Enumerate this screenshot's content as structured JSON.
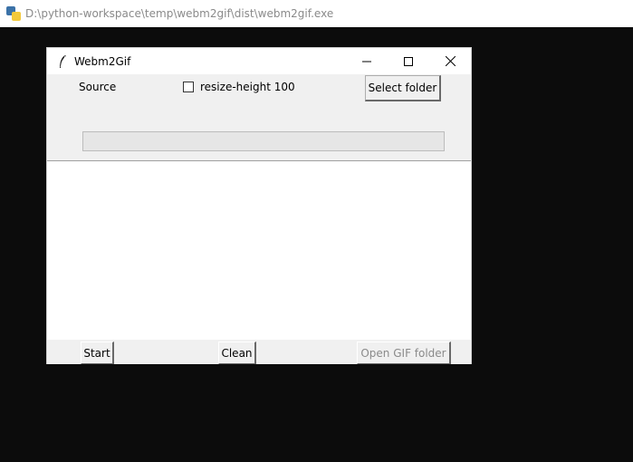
{
  "console": {
    "title": "D:\\python-workspace\\temp\\webm2gif\\dist\\webm2gif.exe",
    "icon": "python-icon"
  },
  "app": {
    "title": "Webm2Gif",
    "icon": "tk-feather-icon",
    "controls": {
      "minimize": "minimize-icon",
      "maximize": "maximize-icon",
      "close": "close-icon"
    }
  },
  "top": {
    "source_label": "Source",
    "resize_checkbox_label": "resize-height 100",
    "resize_checked": false,
    "select_folder_label": "Select folder"
  },
  "progress": {
    "value": 0
  },
  "log": {
    "text": ""
  },
  "bottom": {
    "start_label": "Start",
    "clean_label": "Clean",
    "open_gif_label": "Open GIF folder",
    "open_gif_disabled": true
  }
}
